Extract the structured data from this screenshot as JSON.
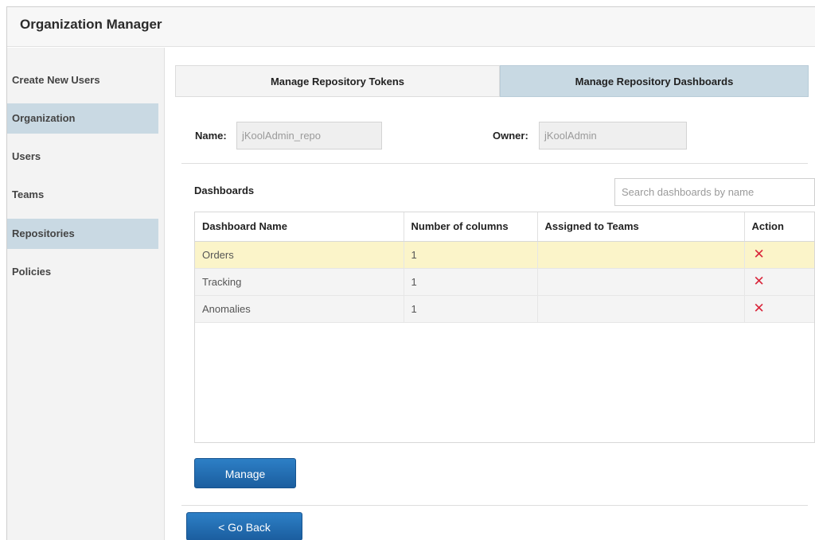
{
  "app": {
    "title": "Organization Manager"
  },
  "sidebar": {
    "items": [
      {
        "label": "Create New Users",
        "active": false
      },
      {
        "label": "Organization",
        "active": true
      },
      {
        "label": "Users",
        "active": false
      },
      {
        "label": "Teams",
        "active": false
      },
      {
        "label": "Repositories",
        "active": true
      },
      {
        "label": "Policies",
        "active": false
      }
    ]
  },
  "tabs": [
    {
      "label": "Manage Repository Tokens",
      "selected": false
    },
    {
      "label": "Manage Repository Dashboards",
      "selected": true
    }
  ],
  "form": {
    "name_label": "Name:",
    "name_value": "jKoolAdmin_repo",
    "owner_label": "Owner:",
    "owner_value": "jKoolAdmin"
  },
  "dashboards": {
    "section_label": "Dashboards",
    "search_placeholder": "Search dashboards by name",
    "columns": [
      "Dashboard Name",
      "Number of columns",
      "Assigned to Teams",
      "Action"
    ],
    "rows": [
      {
        "name": "Orders",
        "columns": "1",
        "teams": "",
        "action_icon": "delete-x-icon",
        "highlighted": true
      },
      {
        "name": "Tracking",
        "columns": "1",
        "teams": "",
        "action_icon": "delete-x-icon",
        "highlighted": false
      },
      {
        "name": "Anomalies",
        "columns": "1",
        "teams": "",
        "action_icon": "delete-x-icon",
        "highlighted": false
      }
    ]
  },
  "buttons": {
    "manage": "Manage",
    "go_back": "< Go Back"
  },
  "colors": {
    "accent_blue": "#1f6ab0",
    "active_tab": "#c8d9e3",
    "row_highlight": "#fbf4c9",
    "delete_red": "#d9263b"
  }
}
